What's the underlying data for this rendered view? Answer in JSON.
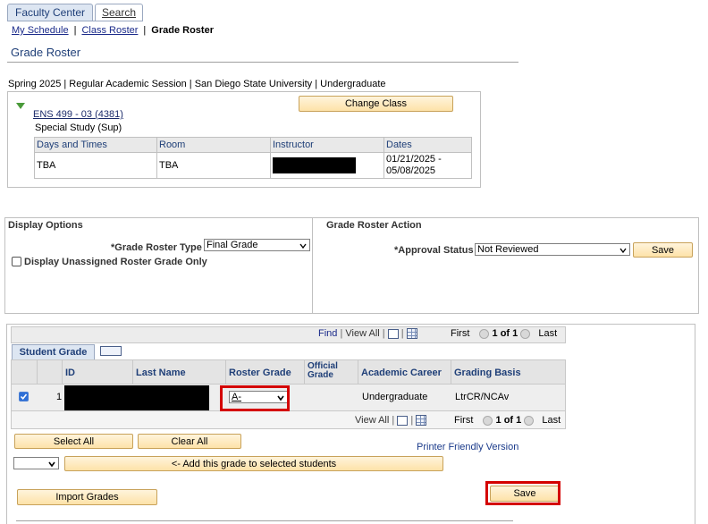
{
  "tabs": [
    {
      "label": "Faculty Center",
      "active": true
    },
    {
      "label": "Search",
      "active": false
    }
  ],
  "breadcrumb": {
    "my_schedule": "My Schedule",
    "class_roster": "Class Roster",
    "grade_roster": "Grade Roster",
    "separator": "|"
  },
  "page_title": "Grade Roster",
  "term_info": "Spring 2025 | Regular Academic Session | San Diego State University | Undergraduate",
  "class_info": {
    "class_link": "ENS 499 - 03 (4381)",
    "class_title": "Special Study (Sup)",
    "change_class_label": "Change Class",
    "meeting_headers": [
      "Days and Times",
      "Room",
      "Instructor",
      "Dates"
    ],
    "meeting": {
      "days_times": "TBA",
      "room": "TBA",
      "instructor": "",
      "dates_line1": "01/21/2025 -",
      "dates_line2": "05/08/2025"
    }
  },
  "display_options": {
    "heading": "Display Options",
    "roster_type_label": "*Grade Roster Type",
    "roster_type_value": "Final Grade",
    "unassigned_label": "Display Unassigned Roster Grade Only"
  },
  "roster_action": {
    "heading": "Grade Roster Action",
    "approval_label": "*Approval Status",
    "approval_value": "Not Reviewed",
    "save_label": "Save"
  },
  "student_grid": {
    "find": "Find",
    "view_all": "View All",
    "first": "First",
    "pagination": "1 of 1",
    "last": "Last",
    "tab_label": "Student Grade",
    "columns": [
      "ID",
      "Last Name",
      "Roster Grade",
      "Official Grade",
      "Academic Career",
      "Grading Basis"
    ],
    "official_grade_line1": "Official",
    "official_grade_line2": "Grade",
    "rows": [
      {
        "num": "1",
        "id": "",
        "last_name": "",
        "roster_grade": "A-",
        "official_grade": "",
        "academic_career": "Undergraduate",
        "grading_basis": "LtrCR/NCAv",
        "checked": true
      }
    ]
  },
  "actions": {
    "select_all": "Select All",
    "clear_all": "Clear All",
    "printer_friendly": "Printer Friendly Version",
    "grade_select_value": "",
    "add_grade": "<- Add this grade to selected students",
    "import_grades": "Import Grades",
    "save": "Save"
  },
  "colors": {
    "accent": "#1f3f78",
    "button_bg": "#fde2a8",
    "highlight_red": "#d40000",
    "grid_header": "#e4e4e4"
  }
}
